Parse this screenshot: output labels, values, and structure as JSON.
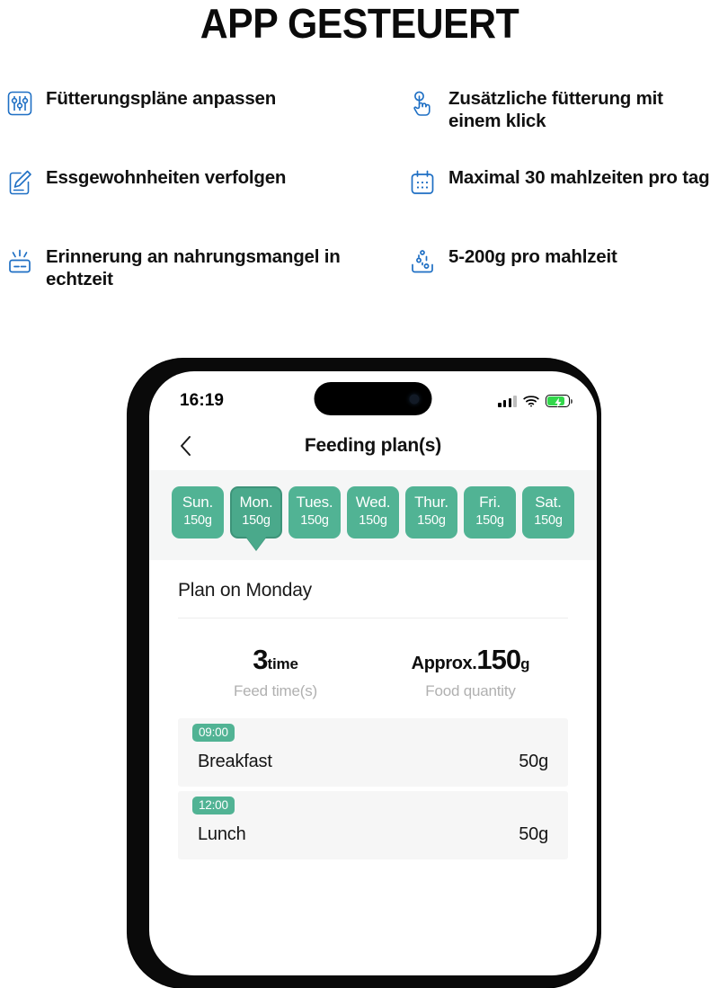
{
  "headline": "APP GESTEUERT",
  "colors": {
    "icon_blue": "#1e6fc4",
    "accent_green": "#51b394",
    "accent_green_dark": "#3d9379",
    "battery_green": "#32d74b"
  },
  "features": {
    "left": [
      {
        "icon": "sliders-icon",
        "text": "Fütterungspläne anpassen"
      },
      {
        "icon": "edit-document-icon",
        "text": "Essgewohnheiten verfolgen"
      },
      {
        "icon": "alert-notification-icon",
        "text": "Erinnerung an nahrungsmangel in echtzeit"
      }
    ],
    "right": [
      {
        "icon": "tap-hand-icon",
        "text": "Zusätzliche fütterung mit einem klick"
      },
      {
        "icon": "calendar-icon",
        "text": "Maximal 30 mahlzeiten pro tag"
      },
      {
        "icon": "food-dispense-icon",
        "text": "5-200g pro mahlzeit"
      }
    ]
  },
  "phone": {
    "status_bar": {
      "time": "16:19",
      "signal_icon": "cellular-signal-icon",
      "wifi_icon": "wifi-icon",
      "battery_icon": "battery-charging-icon"
    },
    "nav": {
      "back_icon": "chevron-left-icon",
      "title": "Feeding plan(s)"
    },
    "days": [
      {
        "name": "Sun.",
        "amount": "150g",
        "selected": false
      },
      {
        "name": "Mon.",
        "amount": "150g",
        "selected": true
      },
      {
        "name": "Tues.",
        "amount": "150g",
        "selected": false
      },
      {
        "name": "Wed.",
        "amount": "150g",
        "selected": false
      },
      {
        "name": "Thur.",
        "amount": "150g",
        "selected": false
      },
      {
        "name": "Fri.",
        "amount": "150g",
        "selected": false
      },
      {
        "name": "Sat.",
        "amount": "150g",
        "selected": false
      }
    ],
    "plan": {
      "title": "Plan on Monday",
      "stats": [
        {
          "prefix": "",
          "value": "3",
          "unit": "time",
          "label": "Feed time(s)"
        },
        {
          "prefix": "Approx.",
          "value": "150",
          "unit": "g",
          "label": "Food quantity"
        }
      ],
      "meals": [
        {
          "time": "09:00",
          "name": "Breakfast",
          "amount": "50g"
        },
        {
          "time": "12:00",
          "name": "Lunch",
          "amount": "50g"
        }
      ]
    }
  }
}
